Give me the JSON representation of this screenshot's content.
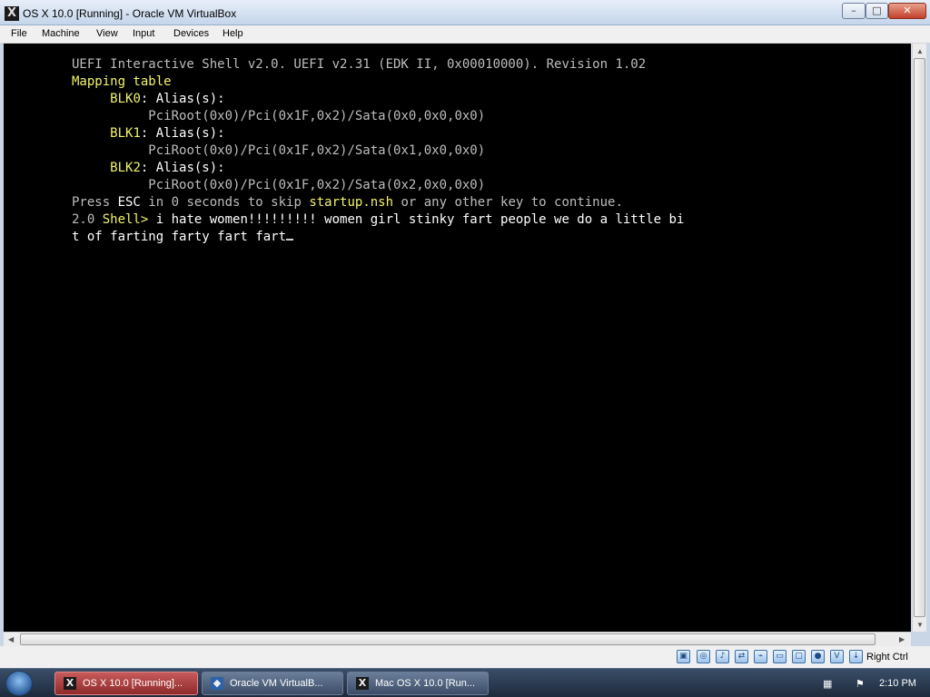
{
  "window": {
    "title": "OS X 10.0 [Running] - Oracle VM VirtualBox",
    "minimize_glyph": "–",
    "maximize_glyph": "□",
    "close_glyph": "✕"
  },
  "menu": [
    "File",
    "Machine",
    "View",
    "Input",
    "Devices",
    "Help"
  ],
  "console": {
    "line1": "UEFI Interactive Shell v2.0. UEFI v2.31 (EDK II, 0x00010000). Revision 1.02",
    "mapping_table": "Mapping table",
    "blk0": "BLK0",
    "blk1": "BLK1",
    "blk2": "BLK2",
    "alias": ": Alias(s):",
    "path0": "PciRoot(0x0)/Pci(0x1F,0x2)/Sata(0x0,0x0,0x0)",
    "path1": "PciRoot(0x0)/Pci(0x1F,0x2)/Sata(0x1,0x0,0x0)",
    "path2": "PciRoot(0x0)/Pci(0x1F,0x2)/Sata(0x2,0x0,0x0)",
    "press": "Press ",
    "esc": "ESC",
    "in_seconds": " in 0 seconds to skip ",
    "startup": "startup.nsh",
    "continue_text": " or any other key to continue.",
    "prompt_prefix": "2.0 ",
    "prompt_shell": "Shell>",
    "input_line1": " i hate women!!!!!!!!! women girl stinky fart people we do a little bi",
    "input_line2": "t of farting farty fart fart"
  },
  "statusbar": {
    "host_key": "Right Ctrl"
  },
  "taskbar": {
    "buttons": [
      {
        "label": "OS X 10.0 [Running]..."
      },
      {
        "label": "Oracle VM VirtualB..."
      },
      {
        "label": "Mac OS X 10.0 [Run..."
      }
    ],
    "clock": "2:10 PM"
  }
}
